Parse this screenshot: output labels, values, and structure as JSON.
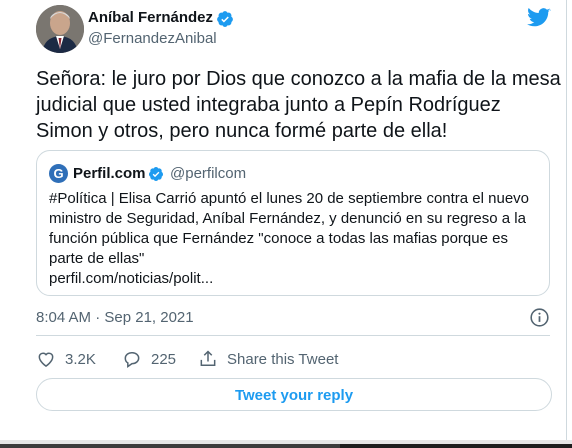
{
  "author": {
    "name": "Aníbal Fernández",
    "handle": "@FernandezAnibal"
  },
  "tweet": {
    "text_lines": [
      "Señora: le juro por Dios que conozco a la mafia de la mesa",
      "judicial que usted integraba junto a Pepín Rodríguez",
      "Simon y otros, pero nunca formé parte de ella!"
    ],
    "timestamp": "8:04 AM · Sep 21, 2021"
  },
  "quoted": {
    "avatar_letter": "G",
    "name": "Perfil.com",
    "handle": "@perfilcom",
    "text_lines": [
      "#Política | Elisa Carrió apuntó el lunes 20 de septiembre contra el nuevo",
      "ministro de Seguridad, Aníbal Fernández, y denunció en su regreso a la",
      "función pública que Fernández \"conoce a todas las mafias porque es",
      "parte de ellas\"",
      "perfil.com/noticias/polit..."
    ]
  },
  "actions": {
    "like_count": "3.2K",
    "reply_count": "225",
    "share_label": "Share this Tweet"
  },
  "reply_button_label": "Tweet your reply",
  "icons": {
    "verified": "verified-badge-icon",
    "brand": "twitter-bird-icon",
    "info": "info-icon",
    "like": "heart-icon",
    "reply": "speech-bubble-icon",
    "share": "share-upload-icon"
  },
  "colors": {
    "accent": "#1d9bf0",
    "text": "#0f1419",
    "secondary_text": "#536471",
    "border": "#cfd9de"
  }
}
